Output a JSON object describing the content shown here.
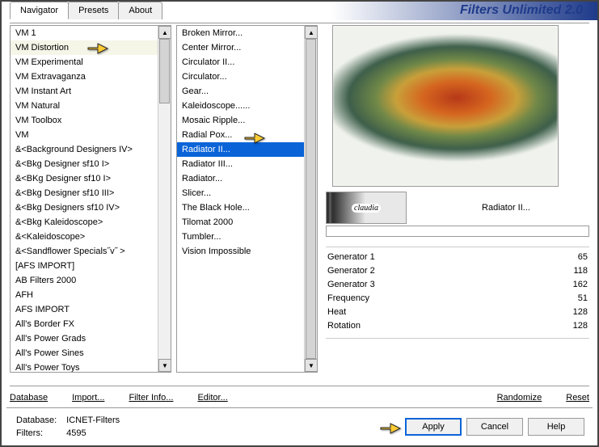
{
  "app_title": "Filters Unlimited 2.0",
  "tabs": [
    {
      "label": "Navigator",
      "active": true
    },
    {
      "label": "Presets",
      "active": false
    },
    {
      "label": "About",
      "active": false
    }
  ],
  "left_list": {
    "items": [
      "VM 1",
      "VM Distortion",
      "VM Experimental",
      "VM Extravaganza",
      "VM Instant Art",
      "VM Natural",
      "VM Toolbox",
      "VM",
      "&<Background Designers IV>",
      "&<Bkg Designer sf10 I>",
      "&<BKg Designer sf10 I>",
      "&<Bkg Designer sf10 III>",
      "&<Bkg Designers sf10 IV>",
      "&<Bkg Kaleidoscope>",
      "&<Kaleidoscope>",
      "&<Sandflower Specials˝v˝ >",
      "[AFS IMPORT]",
      "AB Filters 2000",
      "AFH",
      "AFS IMPORT",
      "All's Border FX",
      "All's Power Grads",
      "All's Power Sines",
      "All's Power Toys"
    ],
    "selected_index": 1
  },
  "mid_list": {
    "items": [
      "Broken Mirror...",
      "Center Mirror...",
      "Circulator II...",
      "Circulator...",
      "Gear...",
      "Kaleidoscope......",
      "Mosaic Ripple...",
      "Radial Pox...",
      "Radiator II...",
      "Radiator III...",
      "Radiator...",
      "Slicer...",
      "The Black Hole...",
      "Tilomat 2000",
      "Tumbler...",
      "Vision Impossible"
    ],
    "selected_index": 8
  },
  "logo_text": "claudia",
  "filter_title": "Radiator II...",
  "params": [
    {
      "name": "Generator 1",
      "value": 65
    },
    {
      "name": "Generator 2",
      "value": 118
    },
    {
      "name": "Generator 3",
      "value": 162
    },
    {
      "name": "Frequency",
      "value": 51
    },
    {
      "name": "Heat",
      "value": 128
    },
    {
      "name": "Rotation",
      "value": 128
    }
  ],
  "toolbar": {
    "database": "Database",
    "import": "Import...",
    "filter_info": "Filter Info...",
    "editor": "Editor...",
    "randomize": "Randomize",
    "reset": "Reset"
  },
  "footer": {
    "db_label": "Database:",
    "db_value": "ICNET-Filters",
    "filters_label": "Filters:",
    "filters_value": "4595",
    "apply": "Apply",
    "cancel": "Cancel",
    "help": "Help"
  }
}
